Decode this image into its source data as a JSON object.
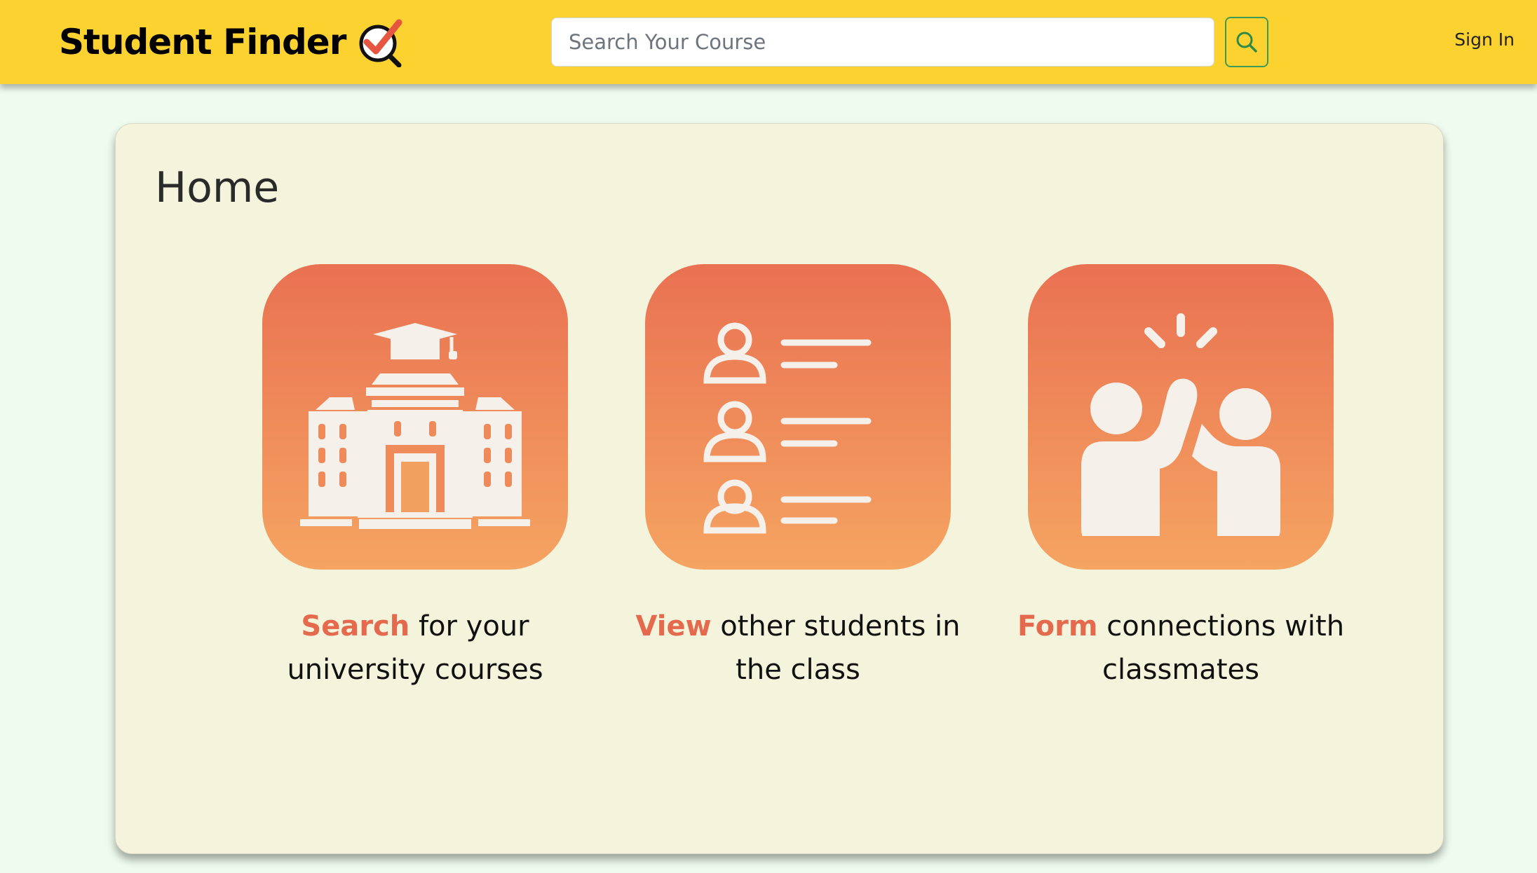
{
  "navbar": {
    "brand": "Student Finder",
    "search_placeholder": "Search Your Course",
    "sign_in": "Sign In"
  },
  "main": {
    "title": "Home",
    "features": [
      {
        "highlight": "Search",
        "text": " for your university courses",
        "icon": "university-icon"
      },
      {
        "highlight": "View",
        "text": " other students in the class",
        "icon": "student-list-icon"
      },
      {
        "highlight": "Form",
        "text": " connections with classmates",
        "icon": "high-five-icon"
      }
    ]
  },
  "colors": {
    "navbar": "#fbd230",
    "page_bg": "#effbee",
    "card_bg": "#f4f4dc",
    "accent": "#e56a4d",
    "tile_top": "#e97152",
    "tile_bottom": "#f5a462",
    "search_button_border": "#3c9a57"
  }
}
